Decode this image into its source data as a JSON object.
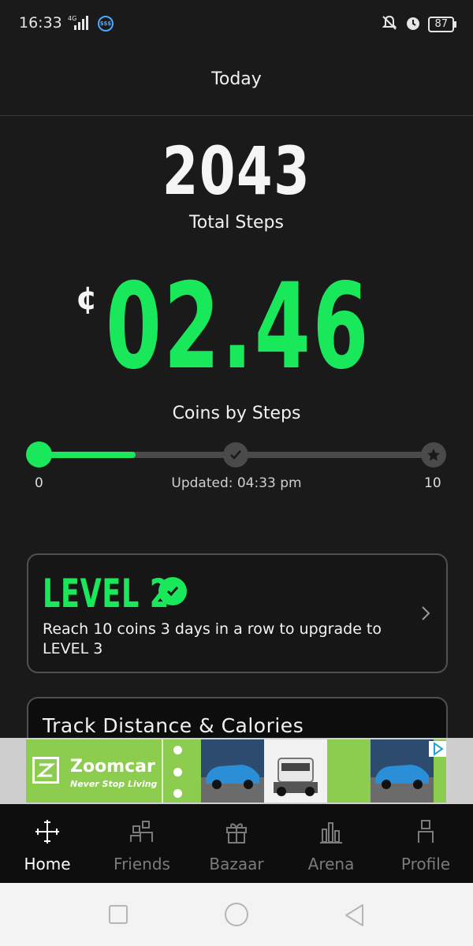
{
  "status_bar": {
    "time": "16:33",
    "network": "4G",
    "app_badge": "$$$",
    "battery": "87"
  },
  "header": {
    "title": "Today"
  },
  "steps": {
    "value": "2043",
    "label": "Total Steps"
  },
  "coins": {
    "symbol": "¢",
    "value": "02.46",
    "label": "Coins by Steps"
  },
  "progress": {
    "min": "0",
    "max": "10",
    "fill_fraction": 0.246,
    "updated": "Updated: 04:33 pm"
  },
  "level": {
    "title": "LEVEL 2",
    "description": "Reach 10 coins 3 days in a row to upgrade to LEVEL 3"
  },
  "track": {
    "title": "Track Distance & Calories"
  },
  "ad": {
    "brand": "Zoomcar",
    "tagline": "Never Stop Living"
  },
  "nav": {
    "items": [
      {
        "label": "Home",
        "icon": "home-icon"
      },
      {
        "label": "Friends",
        "icon": "friends-icon"
      },
      {
        "label": "Bazaar",
        "icon": "gift-icon"
      },
      {
        "label": "Arena",
        "icon": "arena-icon"
      },
      {
        "label": "Profile",
        "icon": "profile-icon"
      }
    ]
  },
  "colors": {
    "accent": "#19e85a",
    "background": "#1a1a1a"
  }
}
